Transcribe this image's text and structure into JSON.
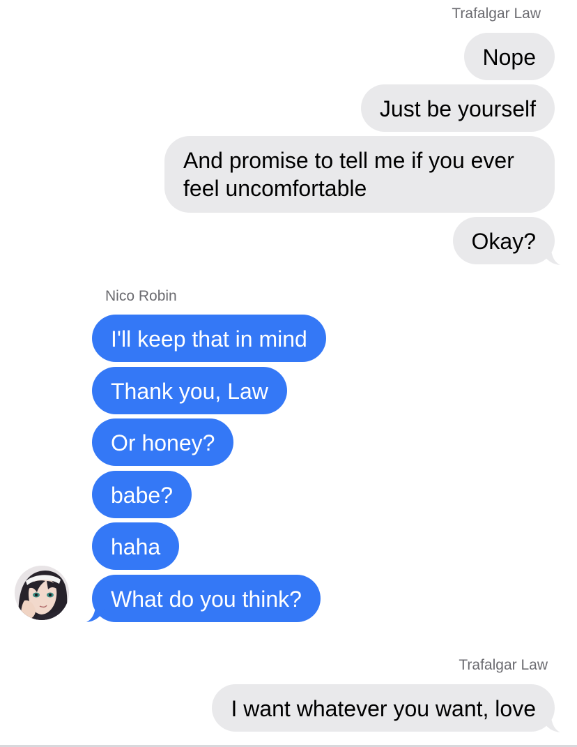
{
  "conversation": {
    "group1": {
      "sender": "Trafalgar Law",
      "messages": [
        "Nope",
        "Just be yourself",
        "And promise to tell me if you ever feel uncomfortable",
        "Okay?"
      ]
    },
    "group2": {
      "sender": "Nico Robin",
      "messages": [
        "I'll keep that in mind",
        "Thank you, Law",
        "Or honey?",
        "babe?",
        "haha",
        "What do you think?"
      ]
    },
    "group3": {
      "sender": "Trafalgar Law",
      "messages": [
        "I want whatever you want, love"
      ]
    }
  },
  "colors": {
    "incoming_bubble": "#3478f6",
    "outgoing_bubble": "#e9e9eb",
    "sender_label": "#6b6b70"
  },
  "icons": {
    "avatar": "nico-robin-avatar"
  }
}
